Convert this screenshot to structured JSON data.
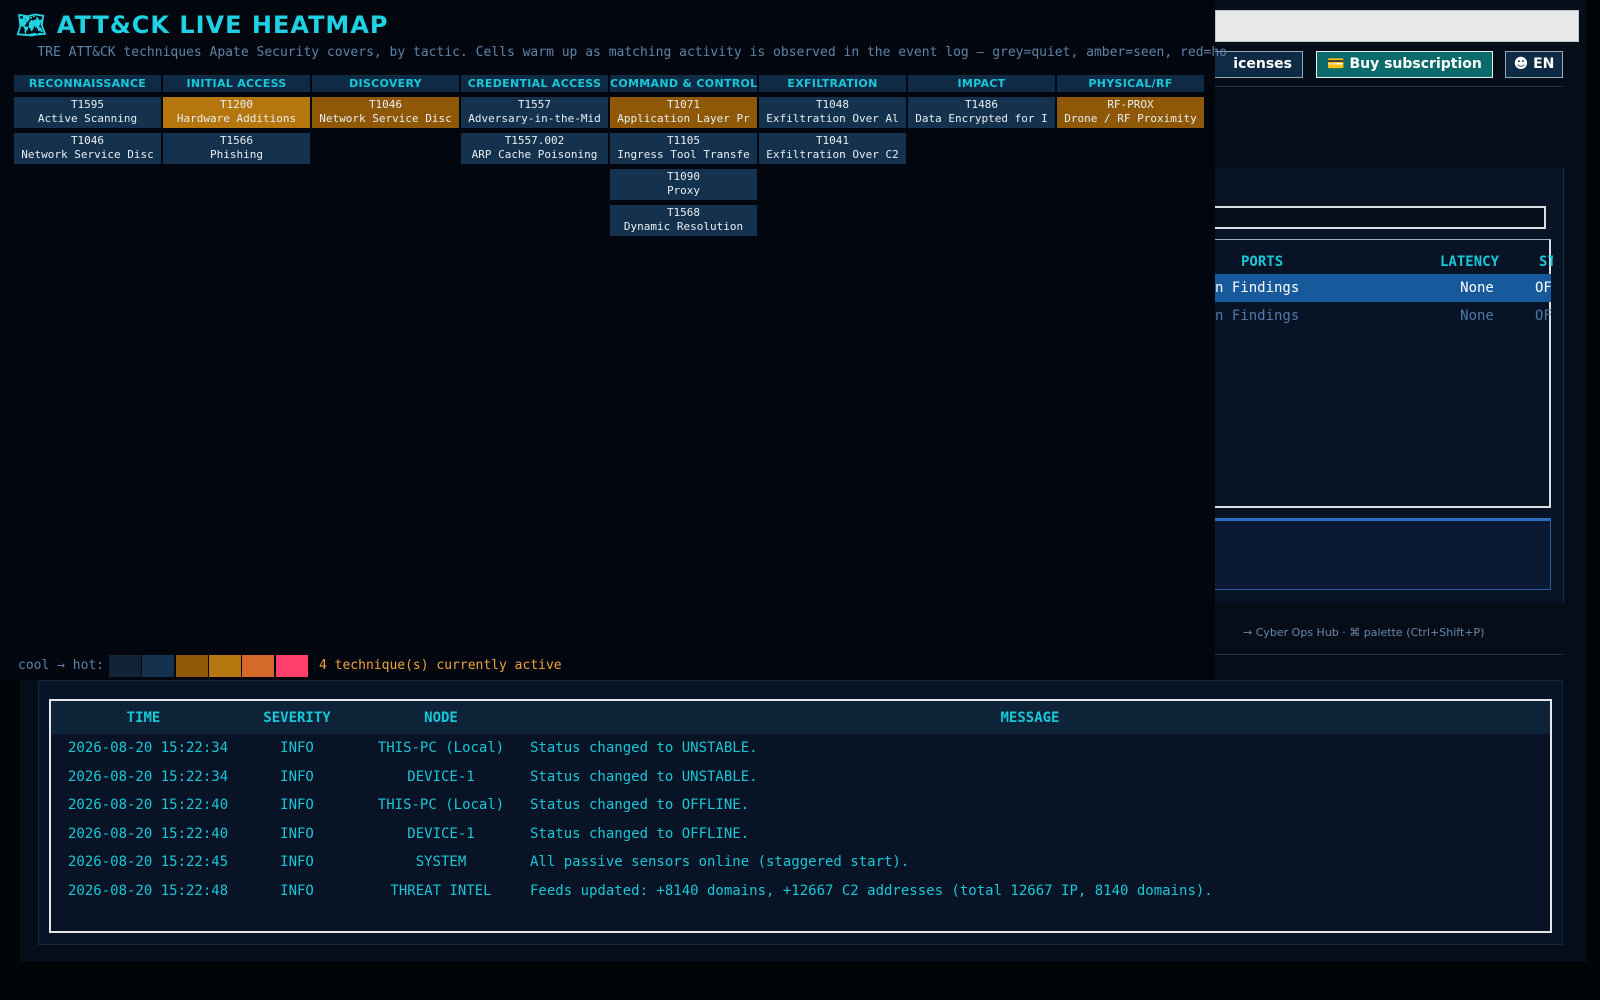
{
  "top_bar": {
    "licenses_label": "icenses",
    "buy_label": "💳 Buy subscription",
    "lang_label": "☻ EN"
  },
  "hosts": {
    "columns": {
      "ports": "PORTS",
      "latency": "LATENCY",
      "status": "ST"
    },
    "rows": [
      {
        "ports": "n Findings",
        "latency": "None",
        "status": "OF"
      },
      {
        "ports": "n Findings",
        "latency": "None",
        "status": "OF"
      }
    ]
  },
  "footer": {
    "links": "→ Cyber Ops Hub  ·  ⌘ palette (Ctrl+Shift+P)"
  },
  "log": {
    "columns": {
      "time": "TIME",
      "severity": "SEVERITY",
      "node": "NODE",
      "message": "MESSAGE"
    },
    "rows": [
      {
        "time": "2026-08-20 15:22:34",
        "severity": "INFO",
        "node": "THIS-PC (Local)",
        "message": "Status changed to UNSTABLE."
      },
      {
        "time": "2026-08-20 15:22:34",
        "severity": "INFO",
        "node": "DEVICE-1",
        "message": "Status changed to UNSTABLE."
      },
      {
        "time": "2026-08-20 15:22:40",
        "severity": "INFO",
        "node": "THIS-PC (Local)",
        "message": "Status changed to OFFLINE."
      },
      {
        "time": "2026-08-20 15:22:40",
        "severity": "INFO",
        "node": "DEVICE-1",
        "message": "Status changed to OFFLINE."
      },
      {
        "time": "2026-08-20 15:22:45",
        "severity": "INFO",
        "node": "SYSTEM",
        "message": "All passive sensors online (staggered start)."
      },
      {
        "time": "2026-08-20 15:22:48",
        "severity": "INFO",
        "node": "THREAT INTEL",
        "message": "Feeds updated: +8140 domains, +12667 C2 addresses (total 12667 IP, 8140 domains)."
      }
    ]
  },
  "heatmap": {
    "title": "🗺 ATT&CK LIVE HEATMAP",
    "subtitle": "TRE ATT&CK techniques Apate Security covers, by tactic. Cells warm up as matching activity is observed in the event log — grey=quiet, amber=seen, red=ho",
    "tactics": [
      {
        "name": "RECONNAISSANCE",
        "cells": [
          {
            "id": "T1595",
            "label": "Active Scanning",
            "level": "quiet"
          },
          {
            "id": "T1046",
            "label": "Network Service Disc",
            "level": "quiet"
          }
        ]
      },
      {
        "name": "INITIAL ACCESS",
        "cells": [
          {
            "id": "T1200",
            "label": "Hardware Additions",
            "level": "hot"
          },
          {
            "id": "T1566",
            "label": "Phishing",
            "level": "quiet"
          }
        ]
      },
      {
        "name": "DISCOVERY",
        "cells": [
          {
            "id": "T1046",
            "label": "Network Service Disc",
            "level": "seen"
          }
        ]
      },
      {
        "name": "CREDENTIAL ACCESS",
        "cells": [
          {
            "id": "T1557",
            "label": "Adversary-in-the-Mid",
            "level": "quiet"
          },
          {
            "id": "T1557.002",
            "label": "ARP Cache Poisoning",
            "level": "quiet"
          }
        ]
      },
      {
        "name": "COMMAND & CONTROL",
        "cells": [
          {
            "id": "T1071",
            "label": "Application Layer Pr",
            "level": "seen"
          },
          {
            "id": "T1105",
            "label": "Ingress Tool Transfe",
            "level": "quiet"
          },
          {
            "id": "T1090",
            "label": "Proxy",
            "level": "quiet"
          },
          {
            "id": "T1568",
            "label": "Dynamic Resolution",
            "level": "quiet"
          }
        ]
      },
      {
        "name": "EXFILTRATION",
        "cells": [
          {
            "id": "T1048",
            "label": "Exfiltration Over Al",
            "level": "quiet"
          },
          {
            "id": "T1041",
            "label": "Exfiltration Over C2",
            "level": "quiet"
          }
        ]
      },
      {
        "name": "IMPACT",
        "cells": [
          {
            "id": "T1486",
            "label": "Data Encrypted for I",
            "level": "quiet"
          }
        ]
      },
      {
        "name": "PHYSICAL/RF",
        "cells": [
          {
            "id": "RF-PROX",
            "label": "Drone / RF Proximity",
            "level": "seen"
          }
        ]
      }
    ],
    "legend": {
      "label": "cool → hot:",
      "colors": [
        "#0f2236",
        "#14324d",
        "#8e5807",
        "#b4760d",
        "#d5692a",
        "#ff3f6a"
      ],
      "active_text": "4 technique(s) currently active"
    }
  }
}
